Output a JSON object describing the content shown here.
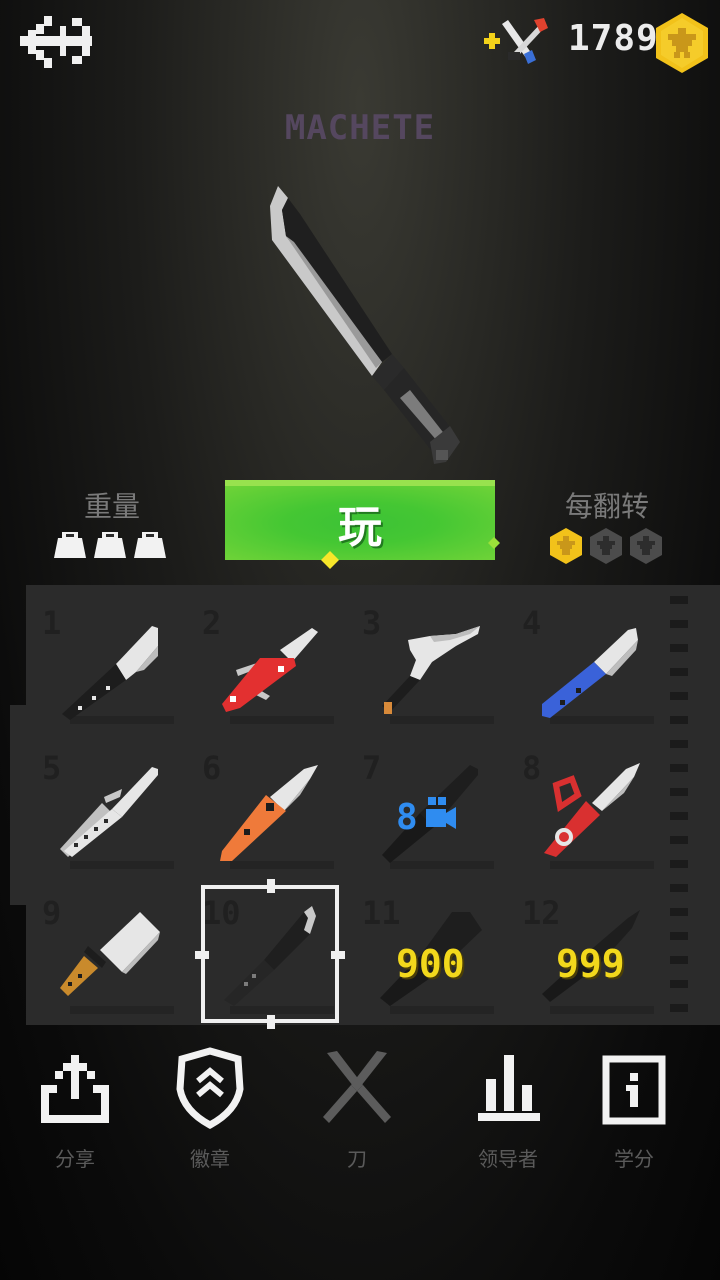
{
  "header": {
    "coin_count": "1789",
    "back_icon": "back-arrow-icon",
    "shop_icon": "add-knife-shop-icon",
    "coin_icon": "gold-coin-icon"
  },
  "selected_knife": {
    "name": "MACHETE",
    "weight_label": "重量",
    "weight_level": 3,
    "weight_max": 3,
    "flip_label": "每翻转",
    "coins_per_flip": 1,
    "coins_per_flip_max": 3
  },
  "play_button": {
    "label": "玩"
  },
  "knives": [
    {
      "number": "1",
      "kind": "kitchen-knife",
      "unlocked": true
    },
    {
      "number": "2",
      "kind": "swiss-army-knife",
      "unlocked": true
    },
    {
      "number": "3",
      "kind": "kukri",
      "unlocked": true
    },
    {
      "number": "4",
      "kind": "blue-handle-knife",
      "unlocked": true
    },
    {
      "number": "5",
      "kind": "butterfly-knife",
      "unlocked": true
    },
    {
      "number": "6",
      "kind": "orange-folding-knife",
      "unlocked": true
    },
    {
      "number": "7",
      "kind": "locked-video-knife",
      "unlocked": false,
      "unlock_text": "8",
      "unlock_icon": "video-camera-icon"
    },
    {
      "number": "8",
      "kind": "red-kunai",
      "unlocked": true
    },
    {
      "number": "9",
      "kind": "cleaver",
      "unlocked": true
    },
    {
      "number": "10",
      "kind": "machete",
      "unlocked": true,
      "selected": true
    },
    {
      "number": "11",
      "kind": "locked-knife",
      "unlocked": false,
      "price": "900"
    },
    {
      "number": "12",
      "kind": "locked-knife",
      "unlocked": false,
      "price": "999"
    }
  ],
  "nav": [
    {
      "label": "分享",
      "icon": "share-icon"
    },
    {
      "label": "徽章",
      "icon": "badge-shield-icon"
    },
    {
      "label": "刀",
      "icon": "crossed-knives-icon"
    },
    {
      "label": "领导者",
      "icon": "leaderboard-icon"
    },
    {
      "label": "学分",
      "icon": "info-icon"
    }
  ],
  "colors": {
    "coin_gold": "#f2c21a",
    "play_green": "#45c733",
    "price_yellow": "#f2d81c",
    "knife_name": "#55475f",
    "panel": "#2b2b2b"
  }
}
